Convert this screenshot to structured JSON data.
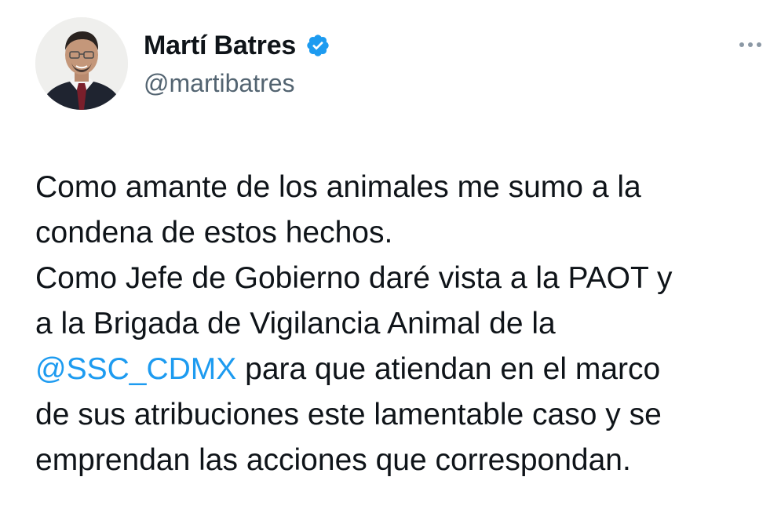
{
  "tweet": {
    "author": {
      "display_name": "Martí Batres",
      "handle": "@martibatres",
      "verified_icon": "verified-badge-icon",
      "avatar_icon": "profile-photo-avatar"
    },
    "menu_icon": "more-options-icon",
    "text_lines": [
      "Como amante de los animales me sumo a la",
      "condena de estos hechos.",
      "Como Jefe de Gobierno daré vista a la PAOT y",
      "a la Brigada de Vigilancia Animal de la"
    ],
    "mention": "@SSC_CDMX",
    "mention_line_rest": " para que atiendan en el marco",
    "text_lines_after": [
      "de sus atribuciones este lamentable caso y se",
      "emprendan las acciones que correspondan."
    ],
    "colors": {
      "mention": "#1d9bf0",
      "verified": "#1d9bf0",
      "handle": "#536471",
      "text": "#0f1419"
    }
  }
}
